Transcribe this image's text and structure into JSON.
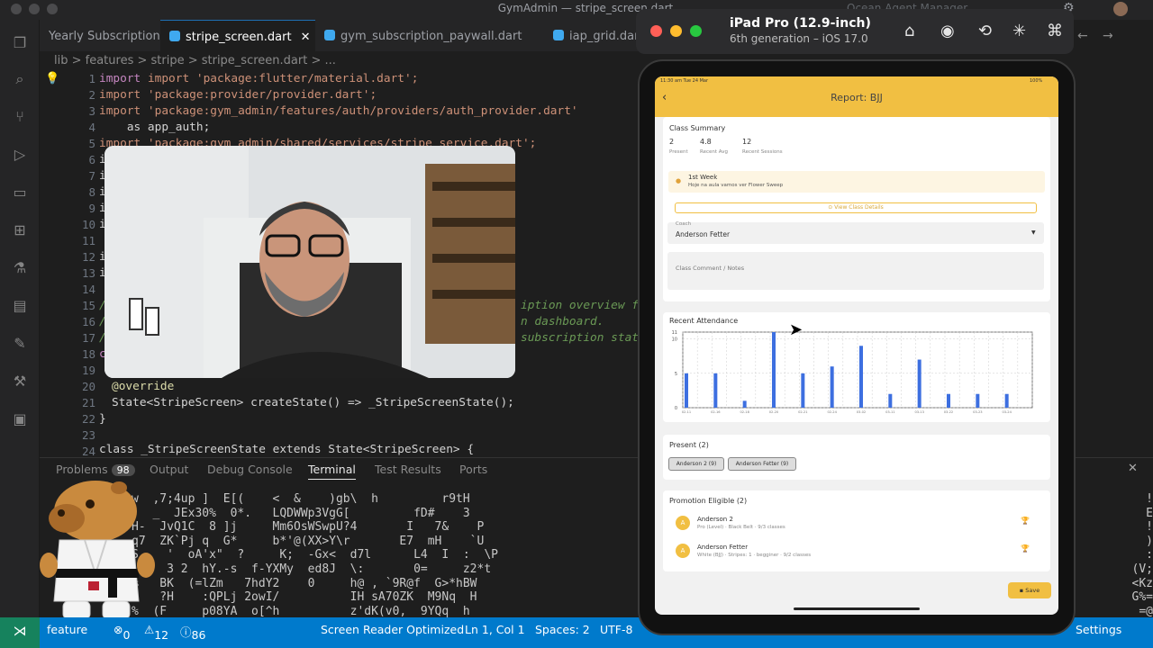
{
  "window": {
    "title": "GymAdmin — stripe_screen.dart",
    "right_label": "Ocean Agent Manager"
  },
  "tabs": [
    {
      "label": "Yearly Subscription"
    },
    {
      "label": "stripe_screen.dart"
    },
    {
      "label": "gym_subscription_paywall.dart"
    },
    {
      "label": "iap_grid.dart"
    }
  ],
  "breadcrumb": "lib > features > stripe > stripe_screen.dart > ...",
  "editor": {
    "line_numbers": [
      "1",
      "2",
      "3",
      "4",
      "5",
      "6",
      "7",
      "8",
      "9",
      "10",
      "11",
      "12",
      "13",
      "14",
      "15",
      "16",
      "17",
      "18",
      "19",
      "20",
      "21",
      "22",
      "23",
      "24"
    ],
    "lines": {
      "l1": "import 'package:flutter/material.dart';",
      "l2": "import 'package:provider/provider.dart';",
      "l3": "import 'package:gym_admin/features/auth/providers/auth_provider.dart'",
      "l4": "    as app_auth;",
      "l5": "import 'package:gym_admin/shared/services/stripe_service.dart';",
      "l6": "i",
      "l7": "i",
      "l8": "i",
      "l9": "i",
      "l10": "i",
      "l12": "i",
      "l13": "i",
      "l15": "/",
      "l15r": "iption overview for",
      "l16": "/",
      "l16r": "n dashboard.",
      "l17": "/",
      "l17r": "subscription statu",
      "l18": "c",
      "l20": "@override",
      "l21": "State<StripeScreen> createState() => _StripeScreenState();",
      "l22": "}",
      "l24": "class _StripeScreenState extends State<StripeScreen> {"
    }
  },
  "panel": {
    "tabs": [
      "Problems",
      "Output",
      "Debug Console",
      "Terminal",
      "Test Results",
      "Ports"
    ],
    "problems_count": "98",
    "terminal_lines": [
      "w  ,7;4up ]  E[(    <  &    )gb\\  h         r9tH",
      ";  _  JEx30%  0*.   LQDWWp3VgG[         fD#    3",
      "H-  JvQ1C  8 ]j     Mm6OsWSwpU?4       I   7&    P",
      "q7  ZK`Pj q  G*     b*'@(XX>Y\\r       E7  mH    `U",
      "S    '  oA'x\"  ?     K;  -Gx<  d7l      L4  I  :  \\P",
      "     3 2  hY.-s  f-YXMy  ed8J  \\:       0=     z2*t",
      "%   BK  (=lZm   7hdY2    0     h@ , `9R@f  G>*hBW",
      "a   ?H    :QPLj 2owI/          IH sA70ZK  M9Nq  H",
      "%  (F     p08YA  o[^h          z'dK(v0,  9YQq  h",
      "j;@       nEpA  c<3      F     aF=b1 `l  y]pl  /"
    ],
    "terminal_right": [
      "!",
      "E",
      "!",
      ")",
      ":",
      "(V;",
      "<Kz",
      "G%=",
      "=@",
      ";=w"
    ]
  },
  "statusbar": {
    "branch": "feature",
    "errors": "0",
    "warnings": "12",
    "info": "86",
    "screen_reader": "Screen Reader Optimized",
    "position": "Ln 1, Col 1",
    "spaces": "Spaces: 2",
    "encoding": "UTF-8",
    "settings": "Settings"
  },
  "simulator": {
    "device": "iPad Pro (12.9-inch)",
    "os": "6th generation – iOS 17.0"
  },
  "app": {
    "status_time": "11:30 am  Tue 24 Mar",
    "status_battery": "100%",
    "title": "Report: BJJ",
    "summary": {
      "heading": "Class Summary",
      "stats": [
        {
          "value": "2",
          "label": "Present"
        },
        {
          "value": "4.8",
          "label": "Recent Avg"
        },
        {
          "value": "12",
          "label": "Recent Sessions"
        }
      ]
    },
    "week": {
      "title": "1st Week",
      "subtitle": "Hoje na aula vamos ver Flower Sweep",
      "button": "View Class Details"
    },
    "coach": {
      "label": "Coach",
      "value": "Anderson Fetter"
    },
    "comment_placeholder": "Class Comment / Notes",
    "attendance": {
      "heading": "Recent Attendance"
    },
    "present": {
      "heading": "Present (2)",
      "chips": [
        "Anderson 2 (9)",
        "Anderson Fetter (9)"
      ]
    },
    "promotion": {
      "heading": "Promotion Eligible (2)",
      "people": [
        {
          "initial": "A",
          "name": "Anderson 2",
          "detail": "Pro (Level) · Black Belt · 9/3 classes"
        },
        {
          "initial": "A",
          "name": "Anderson Fetter",
          "detail": "White (BJJ) · Stripes: 1 · begginer · 9/2 classes"
        }
      ]
    },
    "save": "Save"
  },
  "chart_data": {
    "type": "bar",
    "title": "Recent Attendance",
    "categories": [
      "02-11",
      "02-16",
      "02-18",
      "02-20",
      "02-21",
      "02-24",
      "03-02",
      "03-11",
      "03-13",
      "03-22",
      "03-23",
      "03-24"
    ],
    "values": [
      5,
      5,
      1,
      11,
      5,
      6,
      9,
      2,
      7,
      2,
      2,
      2
    ],
    "yticks": [
      "0",
      "5",
      "10",
      "11"
    ],
    "ylim": [
      0,
      11
    ],
    "colors": {
      "bar": "#3d6fe0"
    },
    "grid": true
  }
}
